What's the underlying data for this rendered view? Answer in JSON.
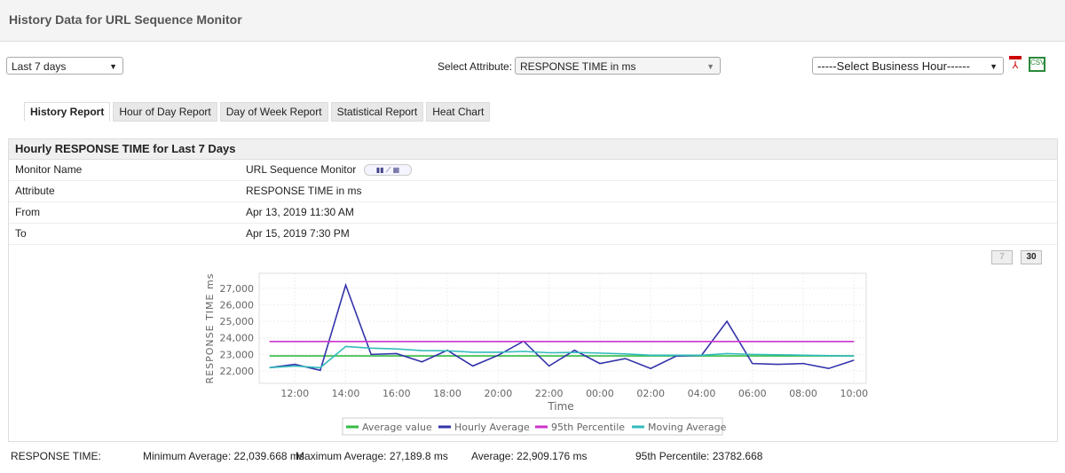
{
  "header": {
    "title": "History Data for URL Sequence Monitor"
  },
  "controls": {
    "period": "Last 7 days",
    "attribute_label": "Select Attribute:",
    "attribute": "RESPONSE TIME in ms",
    "business_hour": "-----Select Business Hour------",
    "pdf_icon": "pdf-icon",
    "csv_icon": "csv-icon"
  },
  "tabs": [
    {
      "label": "History Report",
      "active": true
    },
    {
      "label": "Hour of Day Report"
    },
    {
      "label": "Day of Week Report"
    },
    {
      "label": "Statistical Report"
    },
    {
      "label": "Heat Chart"
    }
  ],
  "panel": {
    "title": "Hourly RESPONSE TIME for Last 7 Days",
    "rows": [
      {
        "k": "Monitor Name",
        "v": "URL Sequence Monitor"
      },
      {
        "k": "Attribute",
        "v": "RESPONSE TIME in ms"
      },
      {
        "k": "From",
        "v": "Apr 13, 2019 11:30 AM"
      },
      {
        "k": "To",
        "v": "Apr 15, 2019 7:30 PM"
      }
    ],
    "btn7": "7",
    "btn30": "30"
  },
  "stats": {
    "label": "RESPONSE TIME:",
    "min": "Minimum Average:  22,039.668  ms",
    "max": "Maximum Average:  27,189.8  ms",
    "avg": "Average:  22,909.176  ms",
    "p95": "95th Percentile:  23782.668"
  },
  "chart_data": {
    "type": "line",
    "xlabel": "Time",
    "ylabel": "RESPONSE TIME ms",
    "ylim": [
      21250,
      27900
    ],
    "yticks": [
      "22,000",
      "23,000",
      "24,000",
      "25,000",
      "26,000",
      "27,000"
    ],
    "xticks": [
      "12:00",
      "14:00",
      "16:00",
      "18:00",
      "20:00",
      "22:00",
      "00:00",
      "02:00",
      "04:00",
      "06:00",
      "08:00",
      "10:00"
    ],
    "x": [
      "11:00",
      "12:00",
      "13:00",
      "14:00",
      "15:00",
      "16:00",
      "17:00",
      "18:00",
      "19:00",
      "20:00",
      "21:00",
      "22:00",
      "23:00",
      "00:00",
      "01:00",
      "02:00",
      "03:00",
      "04:00",
      "05:00",
      "06:00",
      "07:00",
      "08:00",
      "09:00",
      "10:00"
    ],
    "grid": true,
    "legend": "bottom",
    "series": [
      {
        "name": "Average value",
        "color": "#33bb44",
        "values": [
          22909,
          22909,
          22909,
          22909,
          22909,
          22909,
          22909,
          22909,
          22909,
          22909,
          22909,
          22909,
          22909,
          22909,
          22909,
          22909,
          22909,
          22909,
          22909,
          22909,
          22909,
          22909,
          22909,
          22909
        ]
      },
      {
        "name": "Hourly Average",
        "color": "#3333aa",
        "values": [
          22200,
          22400,
          22040,
          27190,
          23000,
          23050,
          22550,
          23250,
          22300,
          22950,
          23800,
          22300,
          23250,
          22450,
          22750,
          22150,
          22900,
          22950,
          25000,
          22450,
          22400,
          22450,
          22150,
          22650
        ]
      },
      {
        "name": "95th Percentile",
        "color": "#cc33cc",
        "values": [
          23782,
          23782,
          23782,
          23782,
          23782,
          23782,
          23782,
          23782,
          23782,
          23782,
          23782,
          23782,
          23782,
          23782,
          23782,
          23782,
          23782,
          23782,
          23782,
          23782,
          23782,
          23782,
          23782,
          23782
        ]
      },
      {
        "name": "Moving Average",
        "color": "#33bbbb",
        "values": [
          22200,
          22300,
          22200,
          23480,
          23380,
          23330,
          23230,
          23220,
          23130,
          23130,
          23180,
          23100,
          23120,
          23080,
          23030,
          22950,
          22950,
          22950,
          23050,
          23000,
          22980,
          22950,
          22920,
          22910
        ]
      }
    ]
  }
}
